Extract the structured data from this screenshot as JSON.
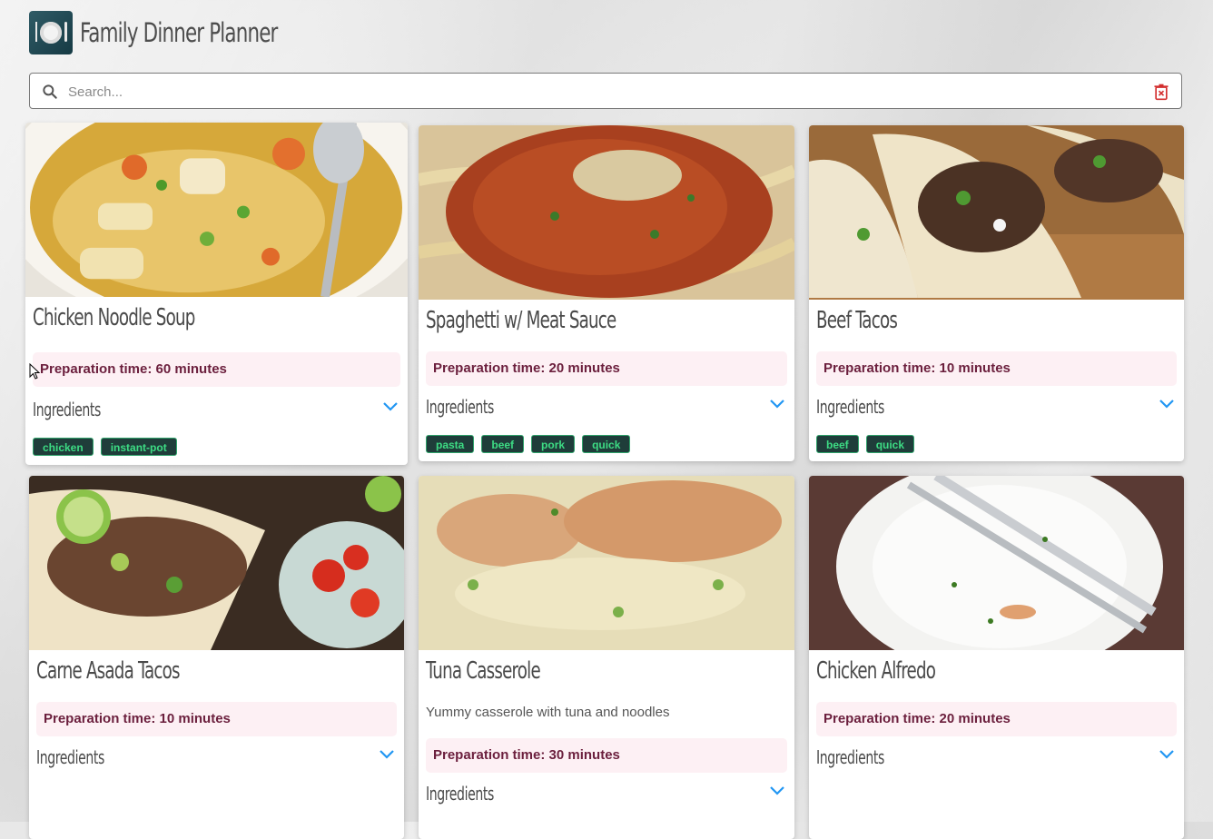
{
  "app": {
    "title": "Family Dinner Planner"
  },
  "search": {
    "placeholder": "Search..."
  },
  "cards": [
    {
      "title": "Chicken Noodle Soup",
      "description": "",
      "prep": "Preparation time: 60 minutes",
      "ingredients_label": "Ingredients",
      "tags": [
        "chicken",
        "instant-pot"
      ]
    },
    {
      "title": "Spaghetti w/ Meat Sauce",
      "description": "",
      "prep": "Preparation time: 20 minutes",
      "ingredients_label": "Ingredients",
      "tags": [
        "pasta",
        "beef",
        "pork",
        "quick"
      ]
    },
    {
      "title": "Beef Tacos",
      "description": "",
      "prep": "Preparation time: 10 minutes",
      "ingredients_label": "Ingredients",
      "tags": [
        "beef",
        "quick"
      ]
    },
    {
      "title": "Carne Asada Tacos",
      "description": "",
      "prep": "Preparation time: 10 minutes",
      "ingredients_label": "Ingredients",
      "tags": []
    },
    {
      "title": "Tuna Casserole",
      "description": "Yummy casserole with tuna and noodles",
      "prep": "Preparation time: 30 minutes",
      "ingredients_label": "Ingredients",
      "tags": []
    },
    {
      "title": "Chicken Alfredo",
      "description": "",
      "prep": "Preparation time: 20 minutes",
      "ingredients_label": "Ingredients",
      "tags": []
    }
  ],
  "colors": {
    "accent": "#2196f3",
    "tag_bg": "#1f3d3a",
    "tag_text": "#3ddc84",
    "prep_bg": "#fdf0f4",
    "prep_text": "#6b1f3d"
  }
}
